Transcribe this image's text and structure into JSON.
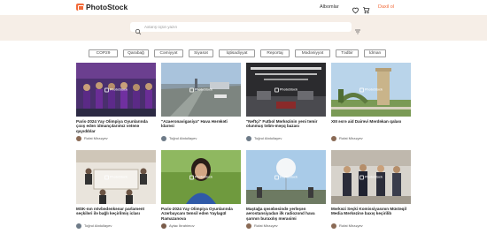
{
  "header": {
    "logo_text": "PhotoStock",
    "albums_label": "Albomlar",
    "login_label": "Daxil ol",
    "accent_color": "#f26b3a"
  },
  "search": {
    "placeholder": "Axtarış üçün yazın",
    "hero_bg": "#f6eee7"
  },
  "tags": [
    "COP29",
    "Qarabağ",
    "Cəmiyyət",
    "Siyasət",
    "İqtisadiyyat",
    "Reportaj",
    "Mədəniyyət",
    "Tədbir",
    "İdman"
  ],
  "watermark": "PhotoStock",
  "cards": [
    {
      "title": "Paris-2024 Yay Olimpiya Oyunlarında çıxış edən idmançılarımız vətənə qayıdıblar",
      "author": "Rufat Mirzəyev"
    },
    {
      "title": "\"Azaeronavigasiya\" Hava Hərəkəti İdarəsi",
      "author": "Toğrul Abdullayev"
    },
    {
      "title": "\"Neftçi\" Futbol Mərkəzinin yeni təmir olunmuş təlim-məşq bazası",
      "author": "Toğrul Abdullayev"
    },
    {
      "title": "XIII əsrə aid Dairəvi Mərdəkan qalası",
      "author": "Rufat Mirzəyev"
    },
    {
      "title": "MSK-nın növbədənkənar parlament seçkiləri ilə bağlı keçirilmiş iclası",
      "author": "Toğrul Abdullayev"
    },
    {
      "title": "Paris-2024 Yay Olimpiya Oyunlarında Azərbaycanı təmsil edən Yaylagül Ramazanova",
      "author": "Aytac İbrahimov"
    },
    {
      "title": "Maştağa qəsəbəsində yerləşən aerostansiyadan ilk radiozond hava şarının buraxılış mərasimi",
      "author": "Rufat Mirzəyev"
    },
    {
      "title": "Mərkəzi Seçki Komissiyasının Müstəqil Media Mərkəzinə baxış keçirilib",
      "author": "Rufat Mirzəyev"
    }
  ]
}
